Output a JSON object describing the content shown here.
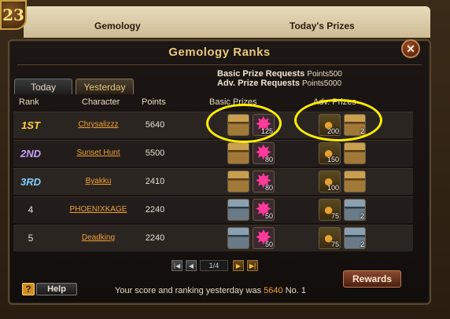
{
  "book": {
    "level": "23",
    "left_tab": "Gemology",
    "right_tab": "Today's Prizes"
  },
  "panel": {
    "title": "Gemology Ranks",
    "close_glyph": "✕"
  },
  "requests": {
    "basic_label": "Basic Prize Requests",
    "basic_value": "Points500",
    "adv_label": "Adv. Prize Requests",
    "adv_value": "Points5000"
  },
  "tabs": {
    "today": "Today",
    "yesterday": "Yesterday"
  },
  "columns": {
    "rank": "Rank",
    "character": "Character",
    "points": "Points",
    "basic": "Basic Prizes",
    "adv": "Adv. Prizes"
  },
  "rows": [
    {
      "rank": "1ST",
      "character": "Chrysalizzz",
      "points": "5640",
      "basic": [
        {
          "type": "chest-gold",
          "qty": ""
        },
        {
          "type": "gem",
          "qty": "125"
        }
      ],
      "adv": [
        {
          "type": "coin",
          "qty": "200"
        },
        {
          "type": "chest-gold",
          "qty": "2"
        }
      ]
    },
    {
      "rank": "2ND",
      "character": "Sunset Hunt",
      "points": "5500",
      "basic": [
        {
          "type": "chest-gold",
          "qty": ""
        },
        {
          "type": "gem",
          "qty": "80"
        }
      ],
      "adv": [
        {
          "type": "coin",
          "qty": "150"
        },
        {
          "type": "chest-gold",
          "qty": ""
        }
      ]
    },
    {
      "rank": "3RD",
      "character": "Byakku",
      "points": "2410",
      "basic": [
        {
          "type": "chest-gold",
          "qty": ""
        },
        {
          "type": "gem",
          "qty": "80"
        }
      ],
      "adv": [
        {
          "type": "coin",
          "qty": "100"
        },
        {
          "type": "chest-gold",
          "qty": ""
        }
      ]
    },
    {
      "rank": "4",
      "character": "PHOENIXKAGE",
      "points": "2240",
      "basic": [
        {
          "type": "chest-silver",
          "qty": ""
        },
        {
          "type": "gem",
          "qty": "50"
        }
      ],
      "adv": [
        {
          "type": "coin",
          "qty": "75"
        },
        {
          "type": "chest-silver",
          "qty": "2"
        }
      ]
    },
    {
      "rank": "5",
      "character": "Deadking",
      "points": "2240",
      "basic": [
        {
          "type": "chest-silver",
          "qty": ""
        },
        {
          "type": "gem",
          "qty": "50"
        }
      ],
      "adv": [
        {
          "type": "coin",
          "qty": "75"
        },
        {
          "type": "chest-silver",
          "qty": "2"
        }
      ]
    }
  ],
  "pagination": {
    "page": "1/4",
    "first": "|◀",
    "prev": "◀",
    "next": "▶",
    "last": "▶|"
  },
  "rewards_label": "Rewards",
  "help": {
    "icon": "?",
    "label": "Help"
  },
  "footer": {
    "text": "Your score and ranking yesterday was",
    "score": "5640",
    "rank": "No. 1"
  }
}
